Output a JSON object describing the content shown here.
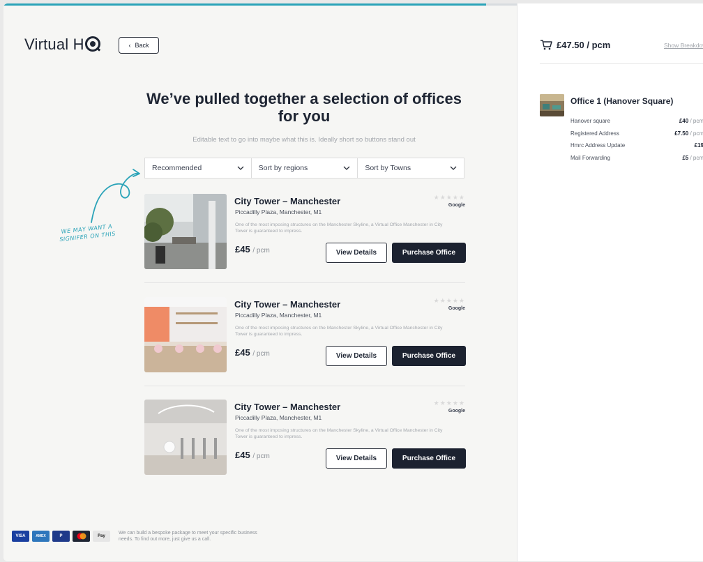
{
  "progress": {
    "fraction": 0.94
  },
  "brand": {
    "logo_text": "Virtual H",
    "logo_q": "Q"
  },
  "header": {
    "back_label": "Back"
  },
  "main": {
    "heading": "We’ve pulled together a selection of offices for you",
    "subtext": "Editable text to go into maybe what this is. Ideally short so buttons stand out",
    "filters": [
      {
        "label": "Recommended"
      },
      {
        "label": "Sort by regions"
      },
      {
        "label": "Sort by Towns"
      }
    ]
  },
  "annotation": {
    "text": "WE MAY WANT A SIGNIFER ON THIS"
  },
  "listings": [
    {
      "title": "City Tower – Manchester",
      "address": "Piccadilly Plaza, Manchester, M1",
      "description": "One of the most imposing structures on the Manchester Skyline, a Virtual Office Manchester in City Tower is guaranteed to impress.",
      "price": "£45",
      "price_unit": "/ pcm",
      "rating_stars": "★★★★★",
      "rating_source": "Google",
      "view_label": "View Details",
      "purchase_label": "Purchase Office"
    },
    {
      "title": "City Tower – Manchester",
      "address": "Piccadilly Plaza, Manchester, M1",
      "description": "One of the most imposing structures on the Manchester Skyline, a Virtual Office Manchester in City Tower is guaranteed to impress.",
      "price": "£45",
      "price_unit": "/ pcm",
      "rating_stars": "★★★★★",
      "rating_source": "Google",
      "view_label": "View Details",
      "purchase_label": "Purchase Office"
    },
    {
      "title": "City Tower – Manchester",
      "address": "Piccadilly Plaza, Manchester, M1",
      "description": "One of the most imposing structures on the Manchester Skyline, a Virtual Office Manchester in City Tower is guaranteed to impress.",
      "price": "£45",
      "price_unit": "/ pcm",
      "rating_stars": "★★★★★",
      "rating_source": "Google",
      "view_label": "View Details",
      "purchase_label": "Purchase Office"
    }
  ],
  "footer": {
    "cards": [
      "VISA",
      "AMEX",
      "P",
      "",
      "Pay"
    ],
    "text": "We can build a bespoke package to meet your specific business needs. To find out more, just give us a call."
  },
  "summary": {
    "total": "£47.50 / pcm",
    "show_breakdown": "Show Breakdown",
    "office_title": "Office 1 (Hanover Square)",
    "items": [
      {
        "label": "Hanover square",
        "amount": "£40",
        "unit": " / pcm"
      },
      {
        "label": "Registered Address",
        "amount": "£7.50",
        "unit": " / pcm"
      },
      {
        "label": "Hmrc Address Update",
        "amount": "£19",
        "unit": ""
      },
      {
        "label": "Mail Forwarding",
        "amount": "£5",
        "unit": " / pcm"
      }
    ]
  },
  "colors": {
    "accent": "#2aa3b8",
    "dark": "#1c2230"
  }
}
